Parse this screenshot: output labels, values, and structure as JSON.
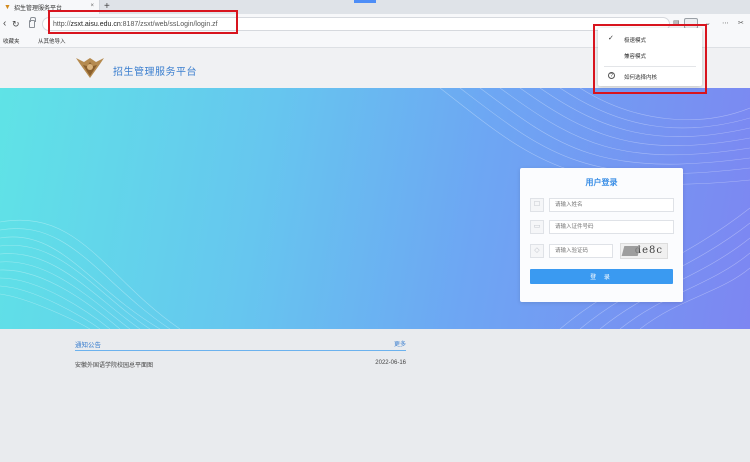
{
  "browser": {
    "tab_title": "招生管理服务平台",
    "tab_close": "×",
    "new_tab": "+",
    "url_scheme": "http://",
    "url_host": "zsxt.aisu.edu.cn",
    "url_path": ":8187/zsxt/web/ssLogin/login.zf",
    "bookmarks": [
      "收藏夹",
      "从其他导入"
    ],
    "menu_items": [
      {
        "label": "极速模式",
        "icon": "check-icon",
        "glyph": "✓"
      },
      {
        "label": "兼容模式",
        "icon": "",
        "glyph": ""
      },
      {
        "label": "如何选择内核",
        "icon": "help-circle-icon",
        "glyph": "?"
      }
    ]
  },
  "site": {
    "title": "招生管理服务平台"
  },
  "login": {
    "title": "用户登录",
    "name_placeholder": "请输入姓名",
    "id_placeholder": "请输入证件号码",
    "captcha_placeholder": "请输入验证码",
    "captcha_text": "de8c",
    "submit_label": "登 录"
  },
  "notice": {
    "title": "通知公告",
    "more": "更多",
    "items": [
      {
        "text": "安徽外国语学院校园总平面图",
        "date": "2022-06-16"
      }
    ]
  },
  "colors": {
    "accent": "#3a8ee6",
    "highlight_box": "#d8141e"
  }
}
